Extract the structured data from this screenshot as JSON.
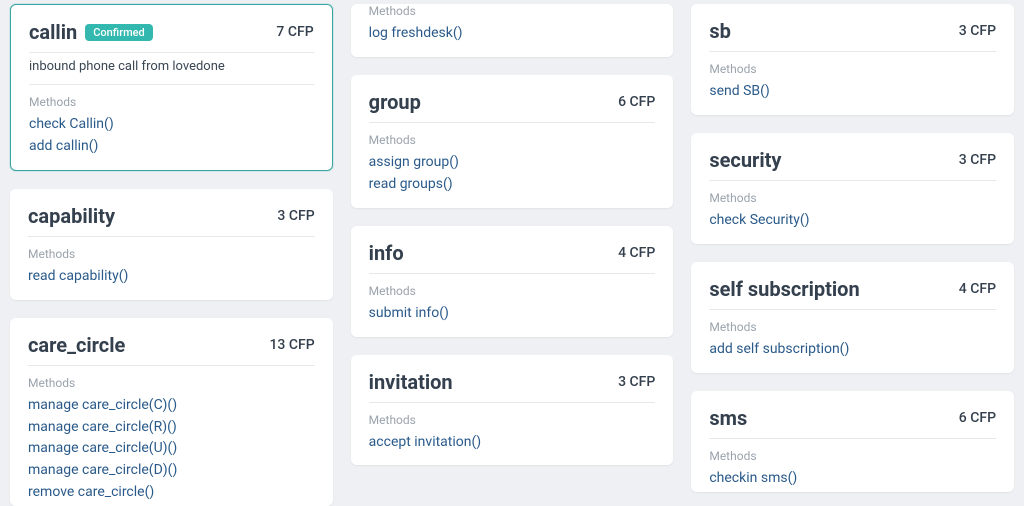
{
  "labels": {
    "methods": "Methods",
    "cfp_unit": "CFP"
  },
  "columns": [
    {
      "cards": [
        {
          "id": "callin",
          "title": "callin",
          "badge": "Confirmed",
          "cfp": 7,
          "description": "inbound phone call from lovedone",
          "selected": true,
          "methods": [
            "check Callin()",
            "add callin()"
          ]
        },
        {
          "id": "capability",
          "title": "capability",
          "cfp": 3,
          "methods": [
            "read capability()"
          ]
        },
        {
          "id": "care_circle",
          "title": "care_circle",
          "cfp": 13,
          "cut_bottom": true,
          "methods": [
            "manage care_circle(C)()",
            "manage care_circle(R)()",
            "manage care_circle(U)()",
            "manage care_circle(D)()",
            "remove care_circle()"
          ]
        }
      ]
    },
    {
      "cards": [
        {
          "id": "freshdesk",
          "cut_top": true,
          "methods": [
            "log freshdesk()"
          ]
        },
        {
          "id": "group",
          "title": "group",
          "cfp": 6,
          "methods": [
            "assign group()",
            "read groups()"
          ]
        },
        {
          "id": "info",
          "title": "info",
          "cfp": 4,
          "methods": [
            "submit info()"
          ]
        },
        {
          "id": "invitation",
          "title": "invitation",
          "cfp": 3,
          "methods": [
            "accept invitation()"
          ]
        }
      ]
    },
    {
      "cards": [
        {
          "id": "sb",
          "title": "sb",
          "cfp": 3,
          "methods": [
            "send SB()"
          ]
        },
        {
          "id": "security",
          "title": "security",
          "cfp": 3,
          "methods": [
            "check Security()"
          ]
        },
        {
          "id": "self_subscription",
          "title": "self subscription",
          "cfp": 4,
          "methods": [
            "add self subscription()"
          ]
        },
        {
          "id": "sms",
          "title": "sms",
          "cfp": 6,
          "cut_bottom": true,
          "methods": [
            "checkin sms()"
          ]
        }
      ]
    }
  ]
}
